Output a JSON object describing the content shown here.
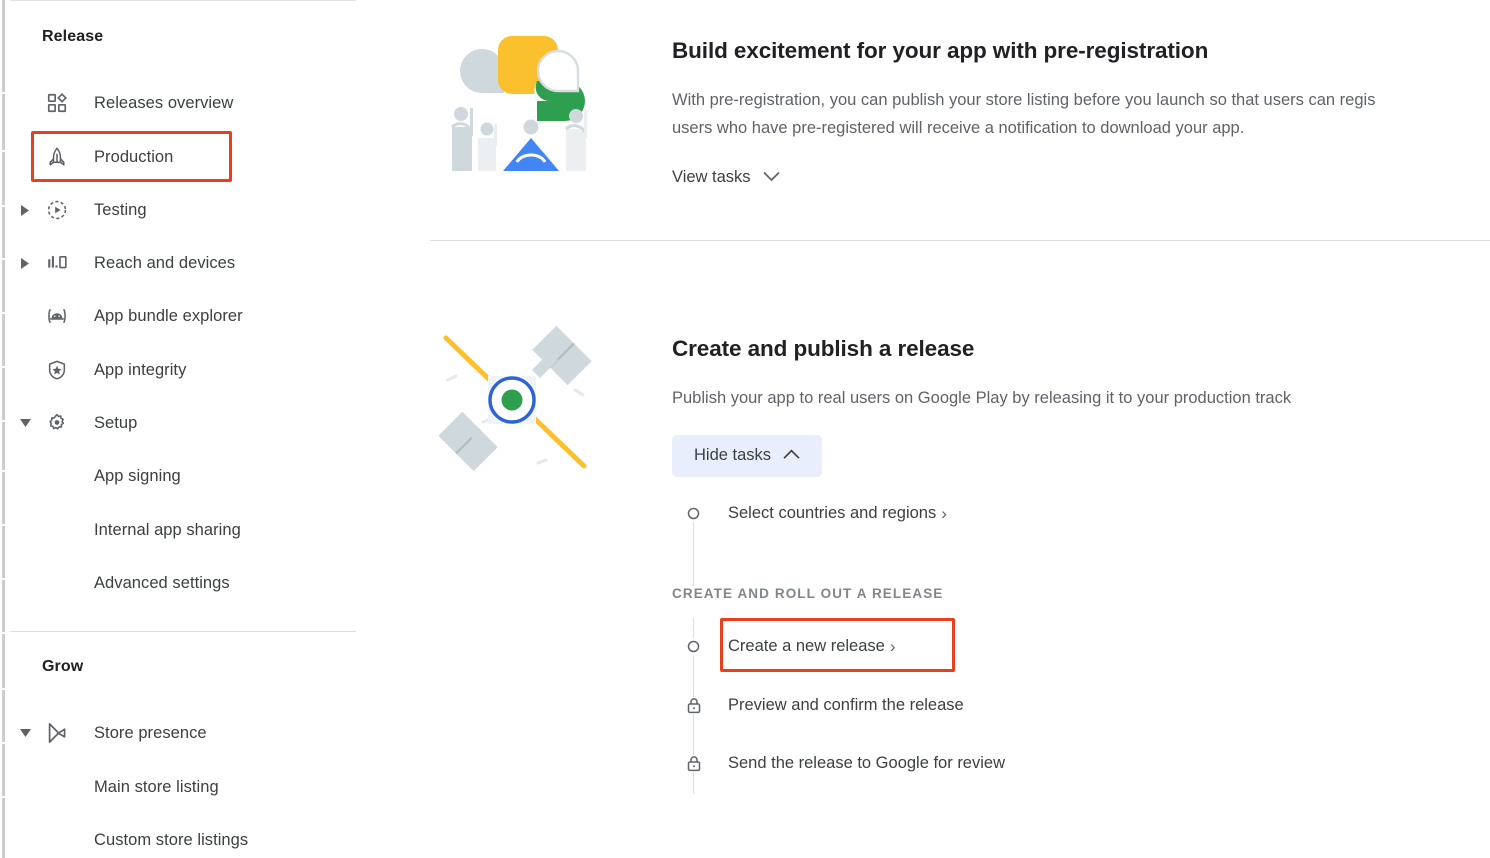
{
  "sidebar": {
    "sections": [
      {
        "title": "Release"
      },
      {
        "title": "Grow"
      }
    ],
    "release_title": "Release",
    "grow_title": "Grow",
    "items": [
      {
        "label": "Releases overview",
        "icon": "grid-diamond-icon",
        "expandable": false,
        "child": false
      },
      {
        "label": "Production",
        "icon": "rocket-icon",
        "expandable": false,
        "child": false,
        "highlighted": true
      },
      {
        "label": "Testing",
        "icon": "play-circle-dashed-icon",
        "expandable": true,
        "expanded": false,
        "child": false
      },
      {
        "label": "Reach and devices",
        "icon": "bar-chart-device-icon",
        "expandable": true,
        "expanded": false,
        "child": false
      },
      {
        "label": "App bundle explorer",
        "icon": "android-bundle-icon",
        "expandable": false,
        "child": false
      },
      {
        "label": "App integrity",
        "icon": "shield-star-icon",
        "expandable": false,
        "child": false
      },
      {
        "label": "Setup",
        "icon": "gear-icon",
        "expandable": true,
        "expanded": true,
        "child": false
      },
      {
        "label": "App signing",
        "icon": "",
        "expandable": false,
        "child": true
      },
      {
        "label": "Internal app sharing",
        "icon": "",
        "expandable": false,
        "child": true
      },
      {
        "label": "Advanced settings",
        "icon": "",
        "expandable": false,
        "child": true
      }
    ],
    "grow_items": [
      {
        "label": "Store presence",
        "icon": "google-play-icon",
        "expandable": true,
        "expanded": true,
        "child": false
      },
      {
        "label": "Main store listing",
        "icon": "",
        "expandable": false,
        "child": true
      },
      {
        "label": "Custom store listings",
        "icon": "",
        "expandable": false,
        "child": true
      }
    ]
  },
  "main": {
    "cards": [
      {
        "id": "pre-registration",
        "illustration": "people-speech-bubbles-illustration",
        "title": "Build excitement for your app with pre-registration",
        "description_line1": "With pre-registration, you can publish your store listing before you launch so that users can regis",
        "description_line2": "users who have pre-registered will receive a notification to download your app.",
        "toggle_label": "View tasks",
        "toggle_state": "collapsed",
        "toggle_icon": "chevron-down-icon"
      },
      {
        "id": "create-publish-release",
        "illustration": "satellite-illustration",
        "title": "Create and publish a release",
        "description_line1": "Publish your app to real users on Google Play by releasing it to your production track",
        "toggle_label": "Hide tasks",
        "toggle_state": "expanded",
        "toggle_icon": "chevron-up-icon",
        "tasks": [
          {
            "label": "Select countries and regions",
            "marker": "circle-outline-icon",
            "chevron": "›",
            "state": "available"
          }
        ],
        "task_group": {
          "title": "CREATE AND ROLL OUT A RELEASE",
          "tasks": [
            {
              "label": "Create a new release",
              "marker": "circle-outline-icon",
              "chevron": "›",
              "state": "available",
              "highlighted": true
            },
            {
              "label": "Preview and confirm the release",
              "marker": "lock-icon",
              "chevron": "",
              "state": "locked"
            },
            {
              "label": "Send the release to Google for review",
              "marker": "lock-icon",
              "chevron": "",
              "state": "locked"
            }
          ]
        }
      }
    ]
  },
  "colors": {
    "highlight_red": "#e8401c",
    "accent_blue": "#e8eefc",
    "text_primary": "#202124",
    "text_secondary": "#5f6368",
    "illustration_yellow": "#fbc02d",
    "illustration_green": "#2e9e4f",
    "illustration_blue": "#4285f4",
    "illustration_gray": "#cfd8dc"
  }
}
